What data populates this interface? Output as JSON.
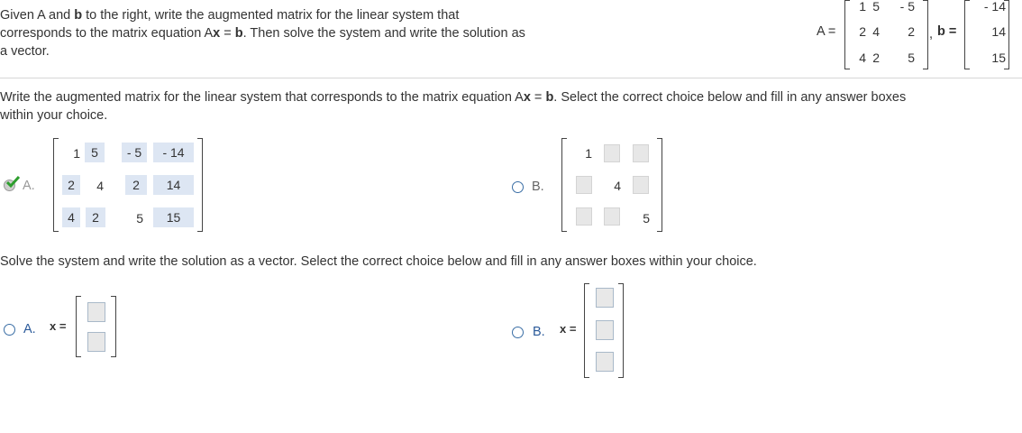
{
  "prompt": {
    "p1": "Given A and ",
    "p1b": "b",
    "p2": " to the right, write the augmented matrix for the linear system that",
    "p3": "corresponds to the matrix equation A",
    "p3x": "x",
    "p4": " = ",
    "p4b": "b",
    "p5": ". Then solve the system and write the solution as",
    "p6": "a vector."
  },
  "given": {
    "A_label": "A =",
    "b_label": "b =",
    "comma": ",",
    "A": [
      [
        "1",
        "5",
        "- 5"
      ],
      [
        "2",
        "4",
        "2"
      ],
      [
        "4",
        "2",
        "5"
      ]
    ],
    "b": [
      "- 14",
      "14",
      "15"
    ]
  },
  "part1": {
    "q1": "Write the augmented matrix for the linear system that corresponds to the matrix equation A",
    "q1x": "x",
    "q1eq": " = ",
    "q1b": "b",
    "q1end": ". Select the correct choice below and fill in any answer boxes",
    "q2": "within your choice.",
    "optionA_label": "A.",
    "optionB_label": "B.",
    "matrixA": [
      [
        "1",
        "5",
        "- 5",
        "- 14"
      ],
      [
        "2",
        "4",
        "2",
        "14"
      ],
      [
        "4",
        "2",
        "5",
        "15"
      ]
    ],
    "matrixB_visible": [
      "1",
      "4",
      "5"
    ]
  },
  "part2": {
    "question": "Solve the system and write the solution as a vector. Select the correct choice below and fill in any answer boxes within your choice.",
    "optionA_label": "A.",
    "optionB_label": "B.",
    "x_label": "x ="
  },
  "colors": {
    "check": "#2e9e2e",
    "radio": "#3a6ea5",
    "shade": "#dde6f3"
  }
}
